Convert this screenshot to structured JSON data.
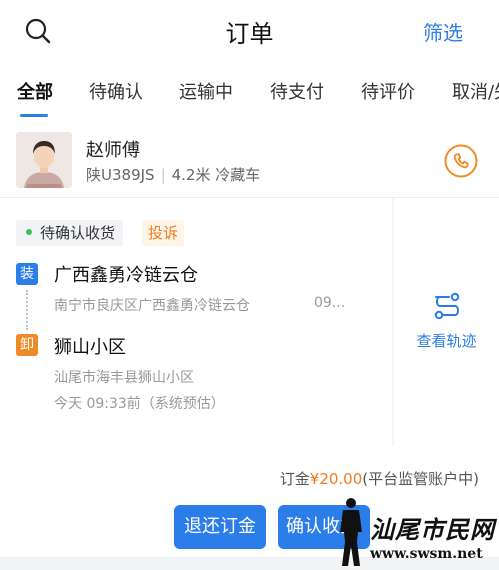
{
  "header": {
    "title": "订单",
    "filter_label": "筛选",
    "search_icon": "search-icon"
  },
  "tabs": [
    {
      "label": "全部",
      "active": true
    },
    {
      "label": "待确认",
      "active": false
    },
    {
      "label": "运输中",
      "active": false
    },
    {
      "label": "待支付",
      "active": false
    },
    {
      "label": "待评价",
      "active": false
    },
    {
      "label": "取消/失",
      "active": false
    }
  ],
  "driver": {
    "name": "赵师傅",
    "plate": "陕U389JS",
    "vehicle": "4.2米 冷藏车",
    "phone_icon": "phone-icon"
  },
  "order": {
    "status": "待确认收货",
    "complaint_label": "投诉",
    "load_tag": "装",
    "unload_tag": "卸",
    "load_name": "广西鑫勇冷链云仓",
    "load_address": "南宁市良庆区广西鑫勇冷链云仓",
    "load_time": "09...",
    "unload_name": "狮山小区",
    "unload_address": "汕尾市海丰县狮山小区",
    "unload_time": "今天 09:33前（系统预估）"
  },
  "track": {
    "label": "查看轨迹",
    "icon": "route-icon"
  },
  "fee": {
    "prefix": "订金",
    "amount": "¥20.00",
    "note": "(平台监管账户中)"
  },
  "actions": {
    "refund_label": "退还订金",
    "confirm_label": "确认收货"
  },
  "watermark": {
    "text": "汕尾市民网",
    "url": "www.swsm.net"
  },
  "colors": {
    "accent": "#2b7de9",
    "warning": "#f08a24",
    "status_dot": "#3fbf5c"
  }
}
